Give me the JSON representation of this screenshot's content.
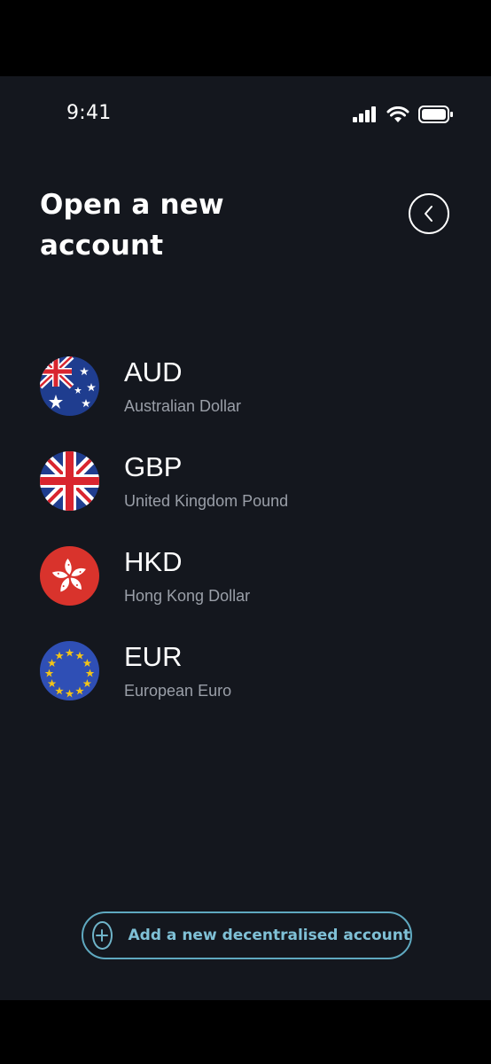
{
  "status_bar": {
    "time": "9:41"
  },
  "header": {
    "title": "Open a new account"
  },
  "currencies": [
    {
      "code": "AUD",
      "name": "Australian Dollar",
      "flag": "australia-flag"
    },
    {
      "code": "GBP",
      "name": "United Kingdom Pound",
      "flag": "uk-flag"
    },
    {
      "code": "HKD",
      "name": "Hong Kong Dollar",
      "flag": "hong-kong-flag"
    },
    {
      "code": "EUR",
      "name": "European Euro",
      "flag": "eu-flag"
    }
  ],
  "footer": {
    "add_label": "Add a new decentralised account"
  },
  "colors": {
    "background": "#14171e",
    "accent": "#7fc0d6",
    "muted_text": "#9a9fa8"
  }
}
